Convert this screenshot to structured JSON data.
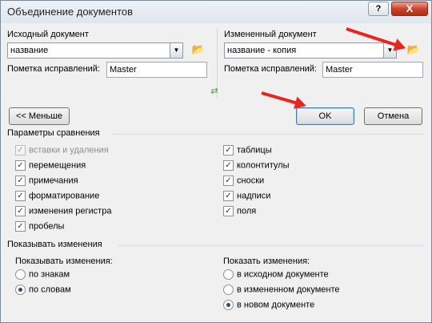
{
  "window": {
    "title": "Объединение документов",
    "help_label": "?",
    "close_label": "X"
  },
  "original": {
    "label": "Исходный документ",
    "value": "название",
    "marking_label": "Пометка исправлений:",
    "marking_value": "Master"
  },
  "revised": {
    "label": "Измененный документ",
    "value": "название - копия",
    "marking_label": "Пометка исправлений:",
    "marking_value": "Master"
  },
  "buttons": {
    "less": "<< Меньше",
    "ok": "OK",
    "cancel": "Отмена"
  },
  "comparison": {
    "title": "Параметры сравнения",
    "left": [
      {
        "label": "вставки и удаления",
        "checked": true,
        "disabled": true
      },
      {
        "label": "перемещения",
        "checked": true,
        "disabled": false
      },
      {
        "label": "примечания",
        "checked": true,
        "disabled": false
      },
      {
        "label": "форматирование",
        "checked": true,
        "disabled": false
      },
      {
        "label": "изменения регистра",
        "checked": true,
        "disabled": false
      },
      {
        "label": "пробелы",
        "checked": true,
        "disabled": false
      }
    ],
    "right": [
      {
        "label": "таблицы",
        "checked": true,
        "disabled": false
      },
      {
        "label": "колонтитулы",
        "checked": true,
        "disabled": false
      },
      {
        "label": "сноски",
        "checked": true,
        "disabled": false
      },
      {
        "label": "надписи",
        "checked": true,
        "disabled": false
      },
      {
        "label": "поля",
        "checked": true,
        "disabled": false
      }
    ]
  },
  "show_changes": {
    "title": "Показывать изменения",
    "level_title": "Показывать изменения:",
    "level_options": [
      {
        "label": "по знакам",
        "selected": false
      },
      {
        "label": "по словам",
        "selected": true
      }
    ],
    "target_title": "Показать изменения:",
    "target_options": [
      {
        "label": "в исходном документе",
        "selected": false
      },
      {
        "label": "в измененном документе",
        "selected": false
      },
      {
        "label": "в новом документе",
        "selected": true
      }
    ]
  },
  "icons": {
    "folder": "folder-open-icon",
    "swap": "swap-arrows-icon",
    "dropdown": "chevron-down-icon"
  },
  "colors": {
    "annotation_arrow": "#e8261e",
    "close_button": "#c9442f",
    "folder": "#d8a31a"
  }
}
